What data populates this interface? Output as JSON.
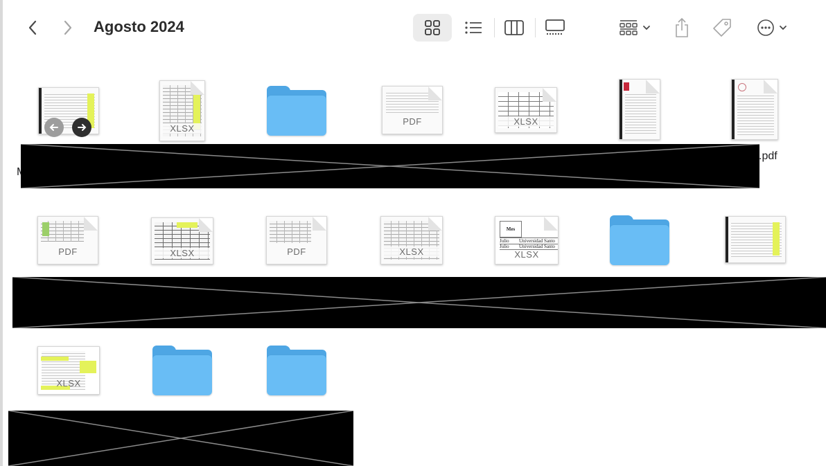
{
  "toolbar": {
    "title": "Agosto 2024",
    "back_icon": "chevron-left-icon",
    "forward_icon": "chevron-right-icon",
    "views": [
      "icon-view-icon",
      "list-view-icon",
      "column-view-icon",
      "gallery-view-icon"
    ],
    "actions": [
      "group-icon",
      "share-icon",
      "tag-icon",
      "more-icon"
    ]
  },
  "files": {
    "row1": [
      {
        "kind": "image",
        "label": ""
      },
      {
        "kind": "xlsx",
        "label": "XLSX"
      },
      {
        "kind": "folder",
        "label": ""
      },
      {
        "kind": "pdf",
        "label": "PDF"
      },
      {
        "kind": "xlsx",
        "label": "XLSX"
      },
      {
        "kind": "doc",
        "label": ""
      },
      {
        "kind": "doc",
        "label": ""
      }
    ],
    "row2": [
      {
        "kind": "pdf",
        "label": "PDF"
      },
      {
        "kind": "xlsx",
        "label": "XLSX"
      },
      {
        "kind": "pdf",
        "label": "PDF"
      },
      {
        "kind": "xlsx",
        "label": "XLSX"
      },
      {
        "kind": "xlsx",
        "label": "XLSX",
        "preview": {
          "header": "Mes",
          "rows": [
            [
              "Julio",
              "Universidad Santo"
            ],
            [
              "Julio",
              "Universidad Santo"
            ]
          ]
        }
      },
      {
        "kind": "folder",
        "label": ""
      },
      {
        "kind": "image",
        "label": ""
      }
    ],
    "row3": [
      {
        "kind": "xlsx",
        "label": "XLSX"
      },
      {
        "kind": "folder",
        "label": ""
      },
      {
        "kind": "folder",
        "label": ""
      }
    ]
  },
  "visible_name_fragments": {
    "row1_right": ".pdf",
    "row1_left": "M"
  },
  "colors": {
    "folder_front": "#69bdf5",
    "folder_back": "#4ea6e4",
    "highlight_yellow": "#e4f25a"
  }
}
